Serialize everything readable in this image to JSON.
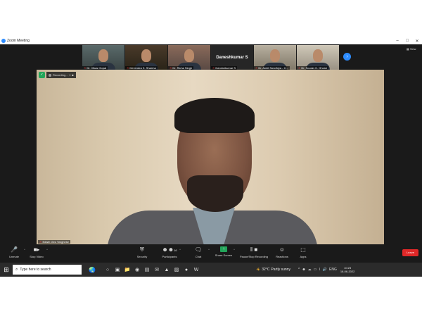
{
  "window": {
    "title": "Zoom Meeting",
    "controls": [
      "–",
      "□",
      "✕"
    ]
  },
  "participants_strip": [
    {
      "name": "Dr. Vikas Gopal",
      "muted": true,
      "has_video": true
    },
    {
      "name": "Devendra K. Sharma",
      "muted": true,
      "has_video": true
    },
    {
      "name": "Dr. Richa Singh",
      "muted": true,
      "has_video": true
    },
    {
      "name": "Daneshkumar S",
      "muted": true,
      "has_video": false
    },
    {
      "name": "Dr. Ankit Sondhiya - C...",
      "muted": true,
      "has_video": true
    },
    {
      "name": "Dr. Sourav K. Ghosh",
      "muted": true,
      "has_video": true
    }
  ],
  "strip_next_icon": "chevron-right-icon",
  "view_label": "View",
  "recording": {
    "label": "Recording...",
    "pause_icon": "pause-icon",
    "stop_icon": "stop-icon"
  },
  "active_speaker": {
    "name": "Edwin Geo Varghese",
    "muted": true
  },
  "toolbar": {
    "unmute": "Unmute",
    "stop_video": "Stop Video",
    "security": "Security",
    "participants": "Participants",
    "participants_count": "16",
    "chat": "Chat",
    "share_screen": "Share Screen",
    "pause_stop_recording": "Pause/Stop Recording",
    "reactions": "Reactions",
    "apps": "Apps",
    "leave": "Leave"
  },
  "taskbar": {
    "search_placeholder": "Type here to search",
    "weather_temp": "32°C",
    "weather_text": "Partly sunny",
    "language": "ENG",
    "time": "10:23",
    "date": "18-06-2022"
  },
  "colors": {
    "accent": "#2d8cff",
    "leave": "#e02828",
    "share": "#23a55a",
    "muted_mic": "#e04040"
  }
}
